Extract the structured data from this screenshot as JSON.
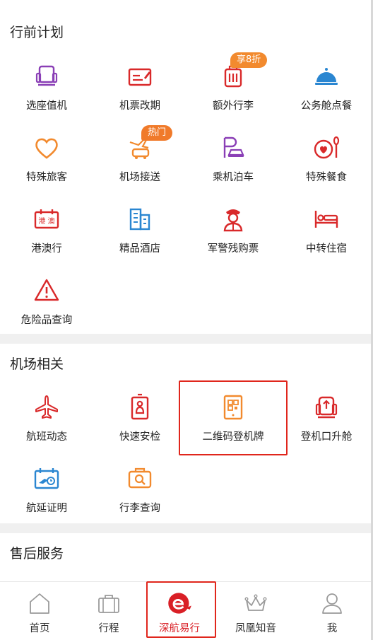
{
  "sections": {
    "pre_trip": {
      "title": "行前计划",
      "items": [
        {
          "label": "选座值机",
          "icon": "seat-icon"
        },
        {
          "label": "机票改期",
          "icon": "ticket-change-icon"
        },
        {
          "label": "额外行李",
          "icon": "luggage-icon",
          "badge": "享8折"
        },
        {
          "label": "公务舱点餐",
          "icon": "cloche-icon"
        },
        {
          "label": "特殊旅客",
          "icon": "heart-icon"
        },
        {
          "label": "机场接送",
          "icon": "airport-transfer-icon",
          "badge": "热门"
        },
        {
          "label": "乘机泊车",
          "icon": "parking-icon"
        },
        {
          "label": "特殊餐食",
          "icon": "special-meal-icon"
        },
        {
          "label": "港澳行",
          "icon": "hk-macau-icon",
          "icon_text": "港 澳"
        },
        {
          "label": "精品酒店",
          "icon": "hotel-icon"
        },
        {
          "label": "军警残购票",
          "icon": "officer-icon"
        },
        {
          "label": "中转住宿",
          "icon": "bed-icon"
        },
        {
          "label": "危险品查询",
          "icon": "warning-icon"
        }
      ]
    },
    "airport": {
      "title": "机场相关",
      "items": [
        {
          "label": "航班动态",
          "icon": "airplane-icon"
        },
        {
          "label": "快速安检",
          "icon": "security-check-icon"
        },
        {
          "label": "二维码登机牌",
          "icon": "qr-boarding-pass-icon"
        },
        {
          "label": "登机口升舱",
          "icon": "upgrade-icon"
        },
        {
          "label": "航延证明",
          "icon": "delay-certificate-icon"
        },
        {
          "label": "行李查询",
          "icon": "baggage-search-icon"
        }
      ]
    },
    "after_sales": {
      "title": "售后服务"
    }
  },
  "tabbar": [
    {
      "label": "首页",
      "icon": "home-icon"
    },
    {
      "label": "行程",
      "icon": "suitcase-icon"
    },
    {
      "label": "深航易行",
      "icon": "e-logo-icon",
      "active": true
    },
    {
      "label": "凤凰知音",
      "icon": "crown-icon"
    },
    {
      "label": "我",
      "icon": "user-icon"
    }
  ],
  "colors": {
    "purple": "#8a3fb6",
    "red": "#d9292a",
    "orange": "#f28a2e",
    "blue": "#2a86d1",
    "active": "#d91f26",
    "gray": "#9a9a9a"
  }
}
